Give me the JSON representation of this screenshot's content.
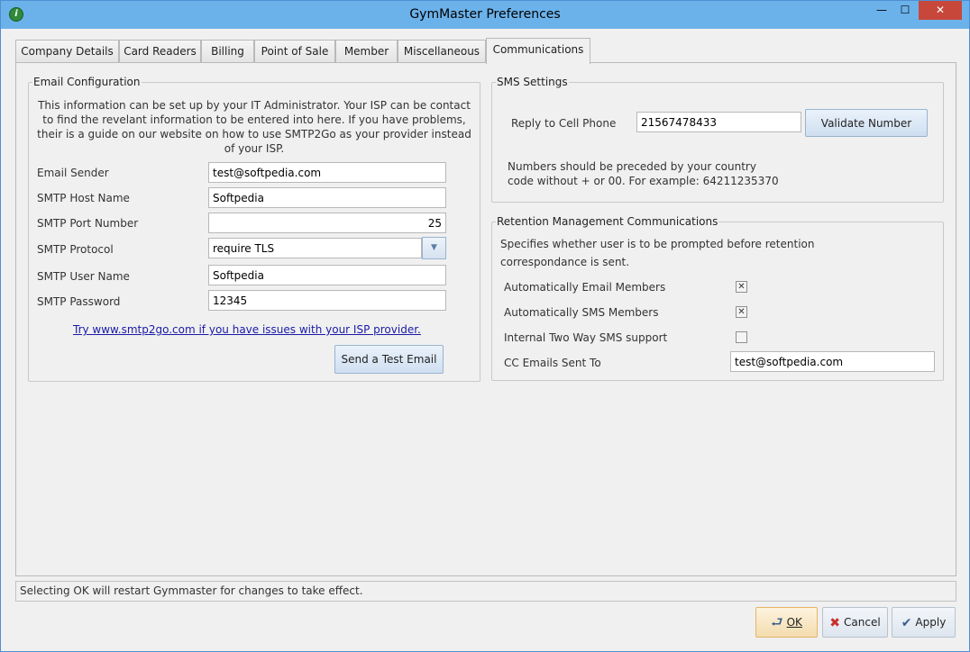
{
  "window": {
    "title": "GymMaster Preferences",
    "app_icon_glyph": "i",
    "controls": {
      "minimize": "—",
      "maximize": "☐",
      "close": "✕"
    }
  },
  "tabs": [
    {
      "label": "Company Details",
      "active": false
    },
    {
      "label": "Card Readers",
      "active": false
    },
    {
      "label": "Billing",
      "active": false
    },
    {
      "label": "Point of Sale",
      "active": false
    },
    {
      "label": "Member",
      "active": false
    },
    {
      "label": "Miscellaneous",
      "active": false
    },
    {
      "label": "Communications",
      "active": true
    }
  ],
  "email_config": {
    "legend": "Email Configuration",
    "info_lines": [
      "This information can be set up by your IT Administrator. Your ISP can be contact",
      "to find the revelant information to be entered into here. If you have problems,",
      "their is a guide on our website on how to use SMTP2Go as your provider instead",
      "of your ISP."
    ],
    "email_sender": {
      "label": "Email Sender",
      "value": "test@softpedia.com"
    },
    "smtp_host": {
      "label": "SMTP Host Name",
      "value": "Softpedia"
    },
    "smtp_port": {
      "label": "SMTP Port Number",
      "value": "25"
    },
    "smtp_protocol": {
      "label": "SMTP Protocol",
      "value": "require TLS"
    },
    "smtp_user": {
      "label": "SMTP User Name",
      "value": "Softpedia"
    },
    "smtp_password": {
      "label": "SMTP Password",
      "value": "12345"
    },
    "link": "Try www.smtp2go.com if you have issues with your ISP provider.",
    "test_button": "Send a Test Email"
  },
  "sms_settings": {
    "legend": "SMS Settings",
    "reply_label": "Reply to Cell Phone",
    "reply_value": "21567478433",
    "validate_button": "Validate Number",
    "note_lines": [
      "Numbers should be preceded by your country",
      "code without + or 00. For example: 64211235370"
    ]
  },
  "retention": {
    "legend": "Retention Management Communications",
    "desc_lines": [
      "Specifies whether user is to be prompted before retention",
      "correspondance is sent."
    ],
    "auto_email": {
      "label": "Automatically Email Members",
      "checked": true
    },
    "auto_sms": {
      "label": "Automatically SMS Members",
      "checked": true
    },
    "two_way_sms": {
      "label": "Internal Two Way SMS support",
      "checked": false
    },
    "cc_emails": {
      "label": "CC Emails Sent To",
      "value": "test@softpedia.com"
    }
  },
  "status": "Selecting OK will restart Gymmaster for changes to take effect.",
  "footer": {
    "ok": "OK",
    "cancel": "Cancel",
    "apply": "Apply"
  },
  "check_glyph": "✕"
}
